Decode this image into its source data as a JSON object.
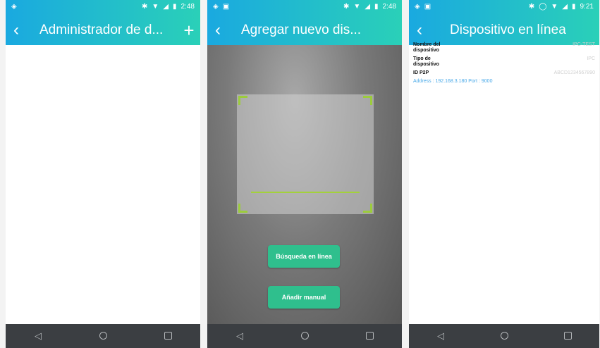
{
  "screens": [
    {
      "status_time": "2:48",
      "back_icon": "back-arrow-icon",
      "title": "Administrador de d...",
      "action_icon": "plus-icon",
      "action_glyph": "+"
    },
    {
      "status_time": "2:48",
      "back_icon": "back-arrow-icon",
      "title": "Agregar nuevo dis...",
      "buttons": {
        "online_search": "Búsqueda en línea",
        "manual_add": "Añadir manual"
      }
    },
    {
      "status_time": "9:21",
      "back_icon": "back-arrow-icon",
      "title": "Dispositivo en línea",
      "details": {
        "device_name_label": "Nombre del dispositivo",
        "device_name_value": "IPC-TEST",
        "device_type_label": "Tipo de dispositivo",
        "device_type_value": "IPC",
        "p2p_label": "ID P2P",
        "p2p_value": "ABCD1234567890",
        "address": "Address : 192.168.3.180 Port : 9000"
      }
    }
  ],
  "nav": {
    "back": "◁",
    "home": "○",
    "recent": "□"
  },
  "colors": {
    "appbar_start": "#1aa9e0",
    "appbar_end": "#2ad0b8",
    "button": "#2fbf8d",
    "scan": "#a3d13b",
    "navbar": "#3b3e42"
  }
}
